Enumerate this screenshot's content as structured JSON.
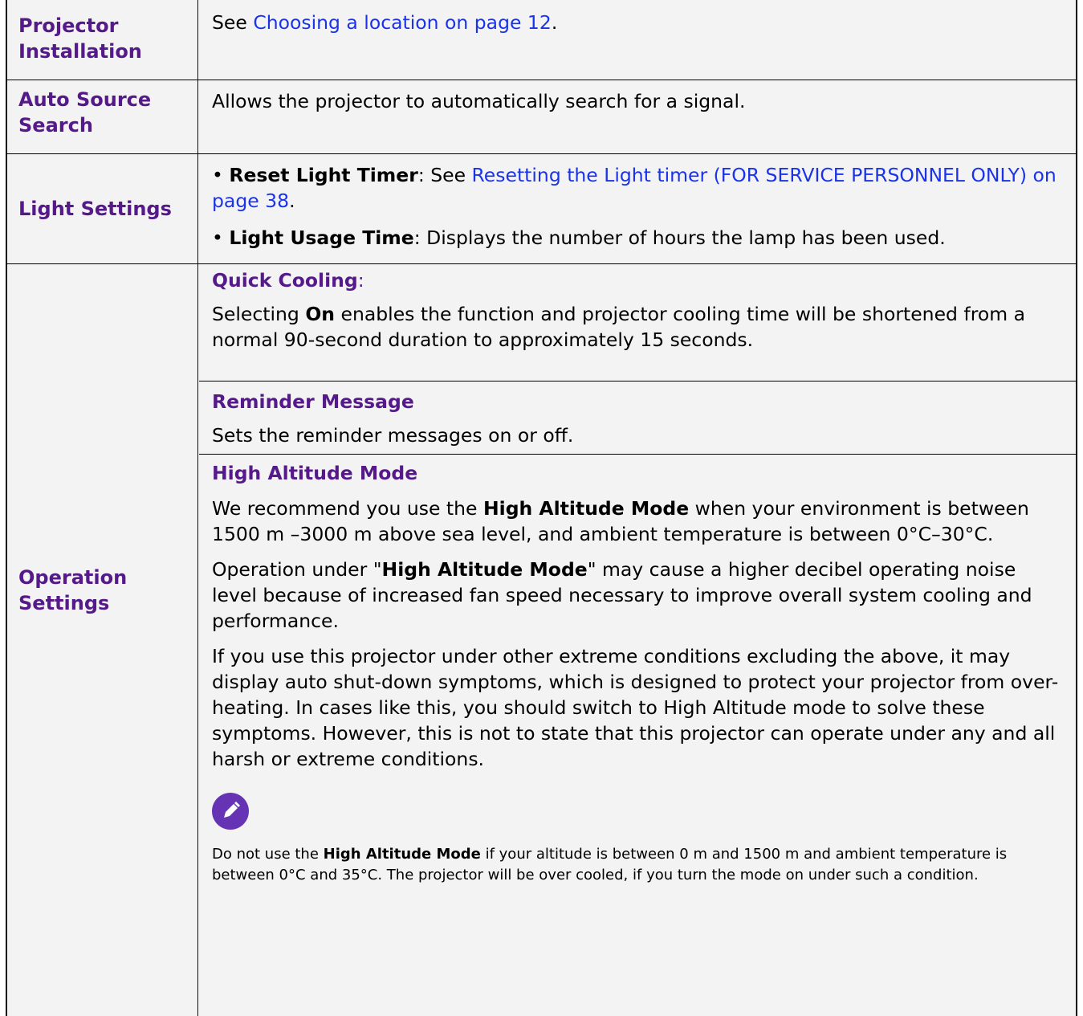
{
  "rows": {
    "r1": {
      "label": "Projector Installation",
      "pre": "See ",
      "link": "Choosing a location on page 12",
      "post": "."
    },
    "r2": {
      "label": "Auto Source Search",
      "text": "Allows the projector to automatically search for a signal."
    },
    "r3": {
      "label": "Light Settings",
      "b1_bold": "Reset Light Timer",
      "b1_pre": ": See ",
      "b1_link": "Resetting the Light timer (FOR SERVICE PERSONNEL ONLY) on page 38",
      "b1_post": ".",
      "b2_bold": "Light Usage Time",
      "b2_text": ": Displays the number of hours the lamp has been used."
    },
    "r4": {
      "label": "Operation Settings",
      "qc_heading": "Quick Cooling",
      "qc_colon": ":",
      "qc_pre": "Selecting ",
      "qc_bold": "On",
      "qc_text": " enables the function and projector cooling time will be shortened from a normal 90-second duration to approximately 15 seconds.",
      "rm_heading": "Reminder Message",
      "rm_text": "Sets the reminder messages on or off.",
      "ha_heading": "High Altitude Mode",
      "ha_p1_pre": "We recommend you use the ",
      "ha_p1_bold": "High Altitude Mode",
      "ha_p1_post": " when your environment is between 1500 m –3000 m above sea level, and ambient temperature is between 0°C–30°C.",
      "ha_p2_pre": "Operation under \"",
      "ha_p2_bold": "High Altitude Mode",
      "ha_p2_post": "\" may cause a higher decibel operating noise level because of increased fan speed necessary to improve overall system cooling and performance.",
      "ha_p3": "If you use this projector under other extreme conditions excluding the above, it may display auto shut-down symptoms, which is designed to protect your projector from over-heating. In cases like this, you should switch to High Altitude mode to solve these symptoms. However, this is not to state that this projector can operate under any and all harsh or extreme conditions.",
      "note_icon": "pencil-icon",
      "note_pre": "Do not use the ",
      "note_bold": "High Altitude Mode",
      "note_post": " if your altitude is between 0 m and 1500 m and ambient temperature is between 0°C and 35°C. The projector will be over cooled, if you turn the mode on under such a condition."
    }
  },
  "colors": {
    "heading": "#55198a",
    "link": "#1a33e8",
    "cell_bg": "#f3f3f3",
    "icon_bg": "#6633b5"
  }
}
